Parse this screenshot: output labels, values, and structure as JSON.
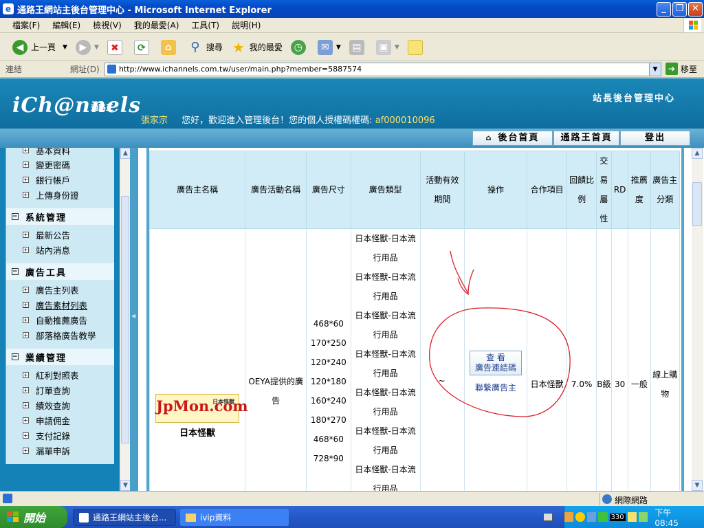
{
  "window": {
    "title": "通路王網站主後台管理中心 - Microsoft Internet Explorer",
    "buttons": {
      "min": "_",
      "max": "❐",
      "close": "✕"
    }
  },
  "menu": [
    "檔案(F)",
    "編輯(E)",
    "檢視(V)",
    "我的最愛(A)",
    "工具(T)",
    "說明(H)"
  ],
  "toolbar": {
    "back": "上一頁",
    "search": "搜尋",
    "favorites": "我的最愛"
  },
  "address": {
    "links_label": "連結",
    "address_label": "網址(D)",
    "url": "http://www.ichannels.com.tw/user/main.php?member=5887574",
    "go": "移至"
  },
  "header": {
    "logo": "iCh@nnels",
    "logo_sub": "通路王",
    "site_title": "站長後台管理中心",
    "user_name": "張家宗",
    "welcome": "您好，歡迎進入管理後台！您的個人授權碼權碼:",
    "auth_code": "af000010096"
  },
  "nav": {
    "home": "後台首頁",
    "site_home": "通路王首頁",
    "logout": "登出"
  },
  "sidebar": {
    "partial_item": "基本資料",
    "account_items": [
      "變更密碼",
      "銀行帳戶",
      "上傳身份證"
    ],
    "groups": [
      {
        "title": "系統管理",
        "items": [
          "最新公告",
          "站內消息"
        ]
      },
      {
        "title": "廣告工具",
        "items": [
          "廣告主列表",
          "廣告素材列表",
          "自動推薦廣告",
          "部落格廣告教學"
        ]
      },
      {
        "title": "業績管理",
        "items": [
          "紅利對照表",
          "訂單查詢",
          "績效查詢",
          "申請佣金",
          "支付記錄",
          "漏單申訴"
        ]
      }
    ]
  },
  "table": {
    "headers": [
      "廣告主名稱",
      "廣告活動名稱",
      "廣告尺寸",
      "廣告類型",
      "活動有效期間",
      "操作",
      "合作項目",
      "回饋比例",
      "交易屬性",
      "RD",
      "推薦度",
      "廣告主分類"
    ],
    "row": {
      "advertiser_logo": "JpMon.com",
      "advertiser_logo_sub": "日本怪獸",
      "advertiser_name": "日本怪獸",
      "campaign": "OEYA提供的廣告",
      "sizes": [
        "468*60",
        "170*250",
        "120*240",
        "120*180",
        "160*240",
        "180*270",
        "468*60",
        "728*90"
      ],
      "ad_type": "日本怪獸-日本流行用品",
      "period": "~",
      "view_button": "查 看\n廣告連結碼",
      "contact": "聯繫廣告主",
      "coop": "日本怪獸",
      "ratio": "7.0%",
      "trade": "B級",
      "rd": "30",
      "recommend": "一般",
      "category": "線上購物"
    }
  },
  "status": {
    "zone": "網際網路"
  },
  "taskbar": {
    "start": "開始",
    "tasks": [
      "通路王網站主後台...",
      "ivip資料"
    ],
    "clock": "下午 08:45",
    "tray_num": "330"
  },
  "colors": {
    "header": "#1a88b8",
    "sidebar": "#1582b7",
    "annotation": "#d8202a"
  }
}
